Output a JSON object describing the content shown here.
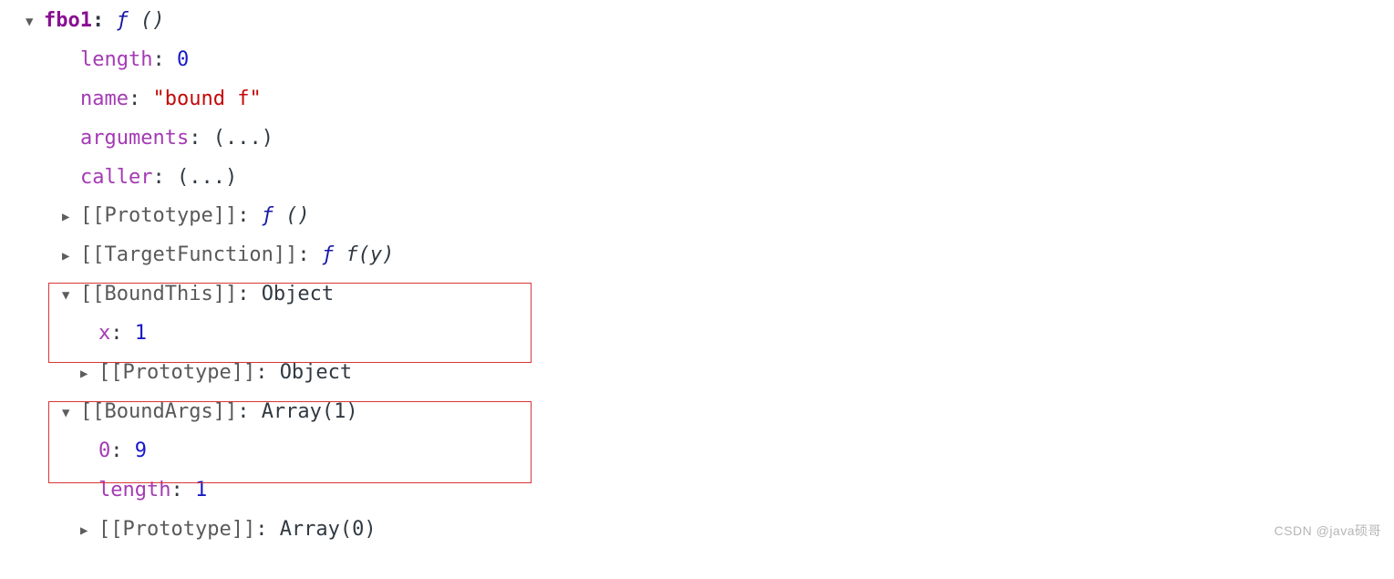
{
  "root": {
    "key": "fbo1",
    "fn_symbol": "ƒ",
    "fn_args": "()"
  },
  "props": {
    "length": {
      "key": "length",
      "value": "0"
    },
    "name": {
      "key": "name",
      "value": "\"bound f\""
    },
    "arguments": {
      "key": "arguments",
      "value": "(...)"
    },
    "caller": {
      "key": "caller",
      "value": "(...)"
    }
  },
  "internals": {
    "prototype": {
      "key": "[[Prototype]]",
      "fn_symbol": "ƒ",
      "fn_args": "()"
    },
    "targetFunction": {
      "key": "[[TargetFunction]]",
      "fn_symbol": "ƒ",
      "fn_args": "f(y)"
    },
    "boundThis": {
      "key": "[[BoundThis]]",
      "value": "Object",
      "x": {
        "key": "x",
        "value": "1"
      },
      "proto": {
        "key": "[[Prototype]]",
        "value": "Object"
      }
    },
    "boundArgs": {
      "key": "[[BoundArgs]]",
      "value": "Array(1)",
      "item0": {
        "key": "0",
        "value": "9"
      },
      "length": {
        "key": "length",
        "value": "1"
      },
      "proto": {
        "key": "[[Prototype]]",
        "value": "Array(0)"
      }
    }
  },
  "watermark": "CSDN @java硕哥"
}
